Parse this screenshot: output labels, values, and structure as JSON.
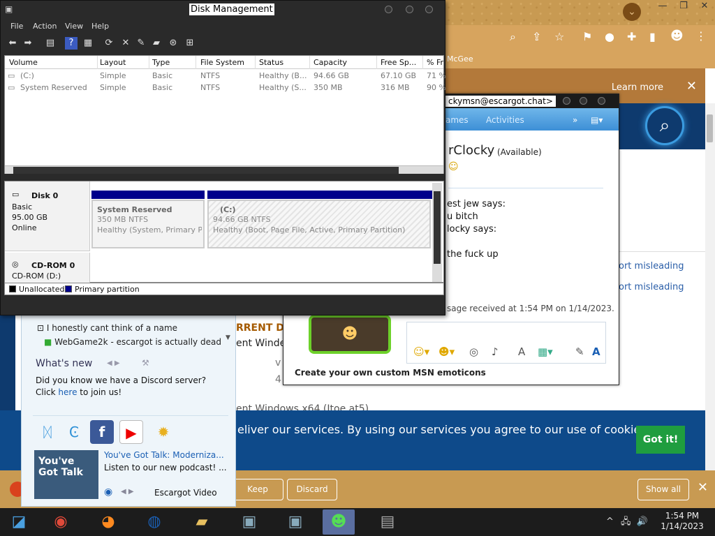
{
  "browser": {
    "bookmark_text": "McGee",
    "learn_more": "Learn more",
    "close_glyph": "✕",
    "report_1": "ort misleading",
    "report_2": "ort misleading",
    "bg_frag_1": "RRENT D",
    "bg_frag_2": "ent Winde",
    "bg_frag_3": "v",
    "bg_frag_4": "4",
    "bg_frag_5": "ent Windows x64 (Itoe at5)",
    "cookie_text": "eliver our services. By using our services you agree to our use of cookies.",
    "cookie_button": "Got it!",
    "download": {
      "keep": "Keep",
      "discard": "Discard",
      "show_all": "Show all"
    },
    "brand_color": "#0e3a6e",
    "accent_green": "#1f9d3f"
  },
  "messenger_list": {
    "row_1": "I honestly cant think of a name",
    "row_2": "WebGame2k - escargot is actually dead h...",
    "whats_new": "What's new",
    "wn_text_pre": "Did you know we have a Discord server? Click ",
    "wn_link": "here",
    "wn_text_post": " to join us!",
    "promo_title": "You've Got Talk: Moderniza...",
    "promo_sub": "Listen to our new podcast! ...",
    "promo_video": "Escargot Video",
    "promo_img": "You've Got Talk",
    "apps": [
      "butterfly-icon",
      "refresh-c-icon",
      "facebook-icon",
      "youtube-icon",
      "sun-icon"
    ]
  },
  "chat": {
    "title": "ckymsn@escargot.chat>",
    "tabs": {
      "games": "ames",
      "activities": "Activities"
    },
    "name": "rClocky",
    "status": "(Available)",
    "line_1": "est jew says:",
    "line_2": "u bitch",
    "line_3": "locky says:",
    "line_4": "the fuck up",
    "received": "sage received at 1:54 PM on 1/14/2023.",
    "ad": "Create your own custom MSN emoticons"
  },
  "disk_mgmt": {
    "title": "Disk Management",
    "menu": [
      "File",
      "Action",
      "View",
      "Help"
    ],
    "columns": [
      "Volume",
      "Layout",
      "Type",
      "File System",
      "Status",
      "Capacity",
      "Free Sp...",
      "% Fr"
    ],
    "volumes": [
      [
        "(C:)",
        "Simple",
        "Basic",
        "NTFS",
        "Healthy (B...",
        "94.66 GB",
        "67.10 GB",
        "71 %"
      ],
      [
        "System Reserved",
        "Simple",
        "Basic",
        "NTFS",
        "Healthy (S...",
        "350 MB",
        "316 MB",
        "90 %"
      ]
    ],
    "disk0": {
      "name": "Disk 0",
      "type": "Basic",
      "size": "95.00 GB",
      "state": "Online"
    },
    "cdrom": {
      "name": "CD-ROM 0",
      "sub": "CD-ROM (D:)"
    },
    "part_sys": {
      "name": "System Reserved",
      "size": "350 MB NTFS",
      "status": "Healthy (System, Primary Par"
    },
    "part_c": {
      "name": "(C:)",
      "size": "94.66 GB NTFS",
      "status": "Healthy (Boot, Page File, Active, Primary Partition)"
    },
    "legend": {
      "unallocated": "Unallocated",
      "primary": "Primary partition"
    },
    "primary_color": "#00008b"
  },
  "taskbar": {
    "time": "1:54 PM",
    "date": "1/14/2023"
  }
}
